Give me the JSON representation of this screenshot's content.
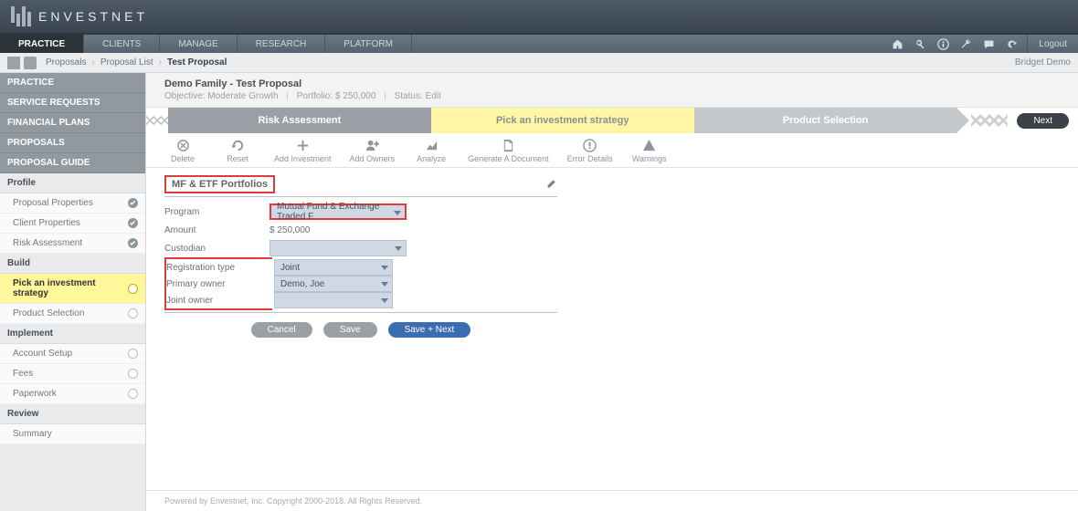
{
  "brand": {
    "name": "ENVESTNET"
  },
  "topnav": {
    "tabs": [
      "PRACTICE",
      "CLIENTS",
      "MANAGE",
      "RESEARCH",
      "PLATFORM"
    ],
    "active": 0,
    "logout": "Logout"
  },
  "breadcrumb": {
    "items": [
      "Proposals",
      "Proposal List"
    ],
    "current": "Test Proposal",
    "user": "Bridget Demo"
  },
  "sidebar": {
    "bigs": [
      "PRACTICE",
      "SERVICE REQUESTS",
      "FINANCIAL PLANS",
      "PROPOSALS",
      "PROPOSAL GUIDE"
    ],
    "groups": [
      {
        "hdr": "Profile",
        "items": [
          {
            "label": "Proposal Properties",
            "state": "check"
          },
          {
            "label": "Client Properties",
            "state": "check"
          },
          {
            "label": "Risk Assessment",
            "state": "check"
          }
        ]
      },
      {
        "hdr": "Build",
        "items": [
          {
            "label": "Pick an investment strategy",
            "state": "cur",
            "active": true
          },
          {
            "label": "Product Selection",
            "state": "open"
          }
        ]
      },
      {
        "hdr": "Implement",
        "items": [
          {
            "label": "Account Setup",
            "state": "open"
          },
          {
            "label": "Fees",
            "state": "open"
          },
          {
            "label": "Paperwork",
            "state": "open"
          }
        ]
      },
      {
        "hdr": "Review",
        "items": [
          {
            "label": "Summary",
            "state": "none"
          }
        ]
      }
    ]
  },
  "header": {
    "title": "Demo Family - Test Proposal",
    "objective_label": "Objective:",
    "objective": "Moderate Growth",
    "portfolio_label": "Portfolio:",
    "portfolio": "$ 250,000",
    "status_label": "Status:",
    "status": "Edit"
  },
  "stepper": {
    "steps": [
      "Risk Assessment",
      "Pick an investment strategy",
      "Product Selection"
    ],
    "next": "Next"
  },
  "toolbar": [
    {
      "name": "delete",
      "label": "Delete"
    },
    {
      "name": "reset",
      "label": "Reset"
    },
    {
      "name": "add-investment",
      "label": "Add Investment"
    },
    {
      "name": "add-owners",
      "label": "Add Owners"
    },
    {
      "name": "analyze",
      "label": "Analyze"
    },
    {
      "name": "generate-document",
      "label": "Generate A Document"
    },
    {
      "name": "error-details",
      "label": "Error Details"
    },
    {
      "name": "warnings",
      "label": "Warnings"
    }
  ],
  "panel": {
    "title": "MF & ETF Portfolios",
    "rows": {
      "program": {
        "label": "Program",
        "value": "Mutual Fund & Exchange Traded F"
      },
      "amount": {
        "label": "Amount",
        "value": "$ 250,000"
      },
      "custodian": {
        "label": "Custodian",
        "value": ""
      },
      "regtype": {
        "label": "Registration type",
        "value": "Joint"
      },
      "primary": {
        "label": "Primary owner",
        "value": "Demo, Joe"
      },
      "joint": {
        "label": "Joint owner",
        "value": ""
      }
    }
  },
  "buttons": {
    "cancel": "Cancel",
    "save": "Save",
    "savenext": "Save + Next"
  },
  "footer": "Powered by Envestnet, Inc. Copyright 2000-2018. All Rights Reserved."
}
